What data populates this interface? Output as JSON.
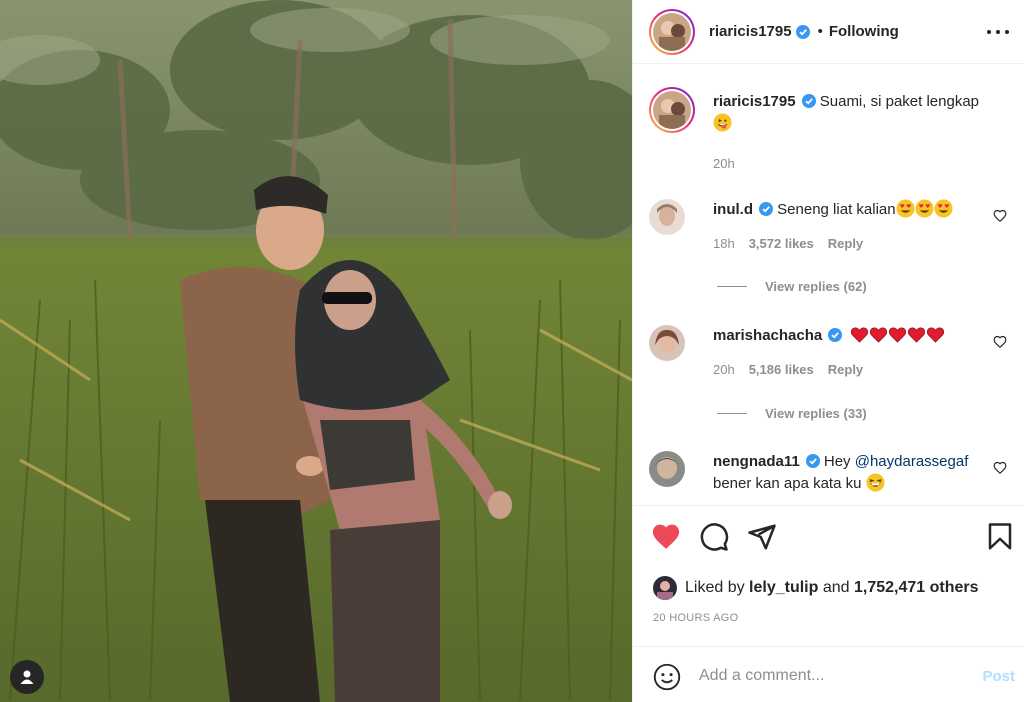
{
  "header": {
    "username": "riaricis1795",
    "separator": "•",
    "follow_status": "Following"
  },
  "caption": {
    "username": "riaricis1795",
    "text": "Suami, si paket lengkap",
    "time": "20h"
  },
  "comments": [
    {
      "username": "inul.d",
      "text": "Seneng liat kalian",
      "emoji": [
        "heart-eyes",
        "heart-eyes",
        "heart-eyes"
      ],
      "time": "18h",
      "likes": "3,572 likes",
      "reply": "Reply",
      "view_replies": "View replies (62)"
    },
    {
      "username": "marishachacha",
      "text": "",
      "emoji": [
        "red-heart",
        "red-heart",
        "red-heart",
        "red-heart",
        "red-heart"
      ],
      "time": "20h",
      "likes": "5,186 likes",
      "reply": "Reply",
      "view_replies": "View replies (33)"
    },
    {
      "username": "nengnada11",
      "text_before": "Hey",
      "mention": "@haydarassegaf",
      "text_after": "bener kan apa kata ku"
    }
  ],
  "likes": {
    "prefix": "Liked by",
    "user": "lely_tulip",
    "joiner": "and",
    "count": "1,752,471 others"
  },
  "timestamp": "20 HOURS AGO",
  "add_comment": {
    "placeholder": "Add a comment...",
    "post_label": "Post"
  },
  "colors": {
    "like_red": "#ed4956",
    "verified_blue": "#3897f0",
    "post_disabled": "#b2dffc",
    "muted_text": "#8e8e8e"
  },
  "icons": [
    "verified-badge-icon",
    "more-options-icon",
    "heart-icon",
    "comment-icon",
    "share-icon",
    "bookmark-icon",
    "smile-icon",
    "user-tag-icon"
  ]
}
